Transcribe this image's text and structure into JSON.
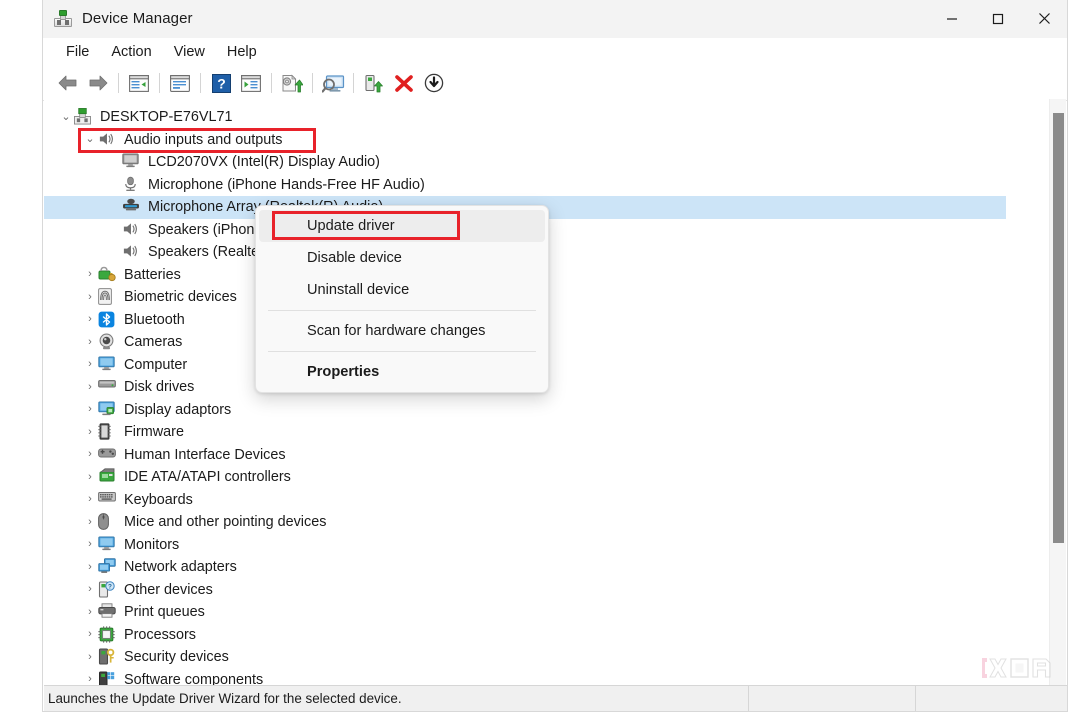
{
  "window": {
    "title": "Device Manager",
    "icon": "device-manager-icon",
    "caption_buttons": [
      {
        "name": "minimize",
        "glyph": "minimize-icon"
      },
      {
        "name": "maximize",
        "glyph": "maximize-icon"
      },
      {
        "name": "close",
        "glyph": "close-icon"
      }
    ]
  },
  "menubar": {
    "items": [
      {
        "label": "File"
      },
      {
        "label": "Action"
      },
      {
        "label": "View"
      },
      {
        "label": "Help"
      }
    ]
  },
  "toolbar": {
    "buttons": [
      {
        "name": "back-icon"
      },
      {
        "name": "forward-icon"
      },
      {
        "name": "separator"
      },
      {
        "name": "show-hide-console-tree-icon"
      },
      {
        "name": "separator"
      },
      {
        "name": "properties-icon"
      },
      {
        "name": "separator"
      },
      {
        "name": "help-icon"
      },
      {
        "name": "show-hide-action-pane-icon"
      },
      {
        "name": "separator"
      },
      {
        "name": "update-driver-icon"
      },
      {
        "name": "separator"
      },
      {
        "name": "scan-for-hardware-changes-icon"
      },
      {
        "name": "separator"
      },
      {
        "name": "enable-device-icon"
      },
      {
        "name": "uninstall-device-icon"
      },
      {
        "name": "disable-device-icon"
      }
    ]
  },
  "tree": {
    "root": {
      "label": "DESKTOP-E76VL71",
      "icon": "computer-root-icon",
      "expanded": true
    },
    "nodes": [
      {
        "label": "Audio inputs and outputs",
        "icon": "speaker-icon",
        "level": 1,
        "expanded": true,
        "highlighted": true
      },
      {
        "label": "LCD2070VX (Intel(R) Display Audio)",
        "icon": "monitor-audio-icon",
        "level": 2,
        "leaf": true
      },
      {
        "label": "Microphone (iPhone Hands-Free HF Audio)",
        "icon": "microphone-icon",
        "level": 2,
        "leaf": true
      },
      {
        "label": "Microphone Array (Realtek(R) Audio)",
        "icon": "microphone-array-icon",
        "level": 2,
        "leaf": true,
        "selected": true
      },
      {
        "label": "Speakers (iPhone Hands-Free HF Audio)",
        "icon": "speaker-icon",
        "level": 2,
        "leaf": true
      },
      {
        "label": "Speakers (Realtek(R) Audio)",
        "icon": "speaker-icon",
        "level": 2,
        "leaf": true
      },
      {
        "label": "Batteries",
        "icon": "battery-icon",
        "level": 1,
        "expanded": false
      },
      {
        "label": "Biometric devices",
        "icon": "fingerprint-icon",
        "level": 1,
        "expanded": false
      },
      {
        "label": "Bluetooth",
        "icon": "bluetooth-icon",
        "level": 1,
        "expanded": false
      },
      {
        "label": "Cameras",
        "icon": "camera-icon",
        "level": 1,
        "expanded": false
      },
      {
        "label": "Computer",
        "icon": "computer-icon",
        "level": 1,
        "expanded": false
      },
      {
        "label": "Disk drives",
        "icon": "disk-drive-icon",
        "level": 1,
        "expanded": false
      },
      {
        "label": "Display adaptors",
        "icon": "display-adapter-icon",
        "level": 1,
        "expanded": false
      },
      {
        "label": "Firmware",
        "icon": "firmware-icon",
        "level": 1,
        "expanded": false
      },
      {
        "label": "Human Interface Devices",
        "icon": "hid-icon",
        "level": 1,
        "expanded": false
      },
      {
        "label": "IDE ATA/ATAPI controllers",
        "icon": "ide-controller-icon",
        "level": 1,
        "expanded": false
      },
      {
        "label": "Keyboards",
        "icon": "keyboard-icon",
        "level": 1,
        "expanded": false
      },
      {
        "label": "Mice and other pointing devices",
        "icon": "mouse-icon",
        "level": 1,
        "expanded": false
      },
      {
        "label": "Monitors",
        "icon": "monitor-icon",
        "level": 1,
        "expanded": false
      },
      {
        "label": "Network adapters",
        "icon": "network-adapter-icon",
        "level": 1,
        "expanded": false
      },
      {
        "label": "Other devices",
        "icon": "other-devices-icon",
        "level": 1,
        "expanded": false
      },
      {
        "label": "Print queues",
        "icon": "printer-icon",
        "level": 1,
        "expanded": false
      },
      {
        "label": "Processors",
        "icon": "processor-icon",
        "level": 1,
        "expanded": false
      },
      {
        "label": "Security devices",
        "icon": "security-device-icon",
        "level": 1,
        "expanded": false
      },
      {
        "label": "Software components",
        "icon": "software-component-icon",
        "level": 1,
        "expanded": false
      }
    ]
  },
  "context_menu": {
    "items": [
      {
        "label": "Update driver",
        "hover": true,
        "bold": false
      },
      {
        "label": "Disable device",
        "hover": false,
        "bold": false
      },
      {
        "label": "Uninstall device",
        "hover": false,
        "bold": false
      },
      {
        "separator": true
      },
      {
        "label": "Scan for hardware changes",
        "hover": false,
        "bold": false
      },
      {
        "separator": true
      },
      {
        "label": "Properties",
        "hover": false,
        "bold": true
      }
    ]
  },
  "statusbar": {
    "text": "Launches the Update Driver Wizard for the selected device."
  },
  "annotations": {
    "color": "#e8222a",
    "boxes": [
      {
        "name": "audio-inputs-and-outputs-highlight"
      },
      {
        "name": "update-driver-highlight"
      }
    ]
  },
  "watermark": {
    "text": "XDA"
  }
}
